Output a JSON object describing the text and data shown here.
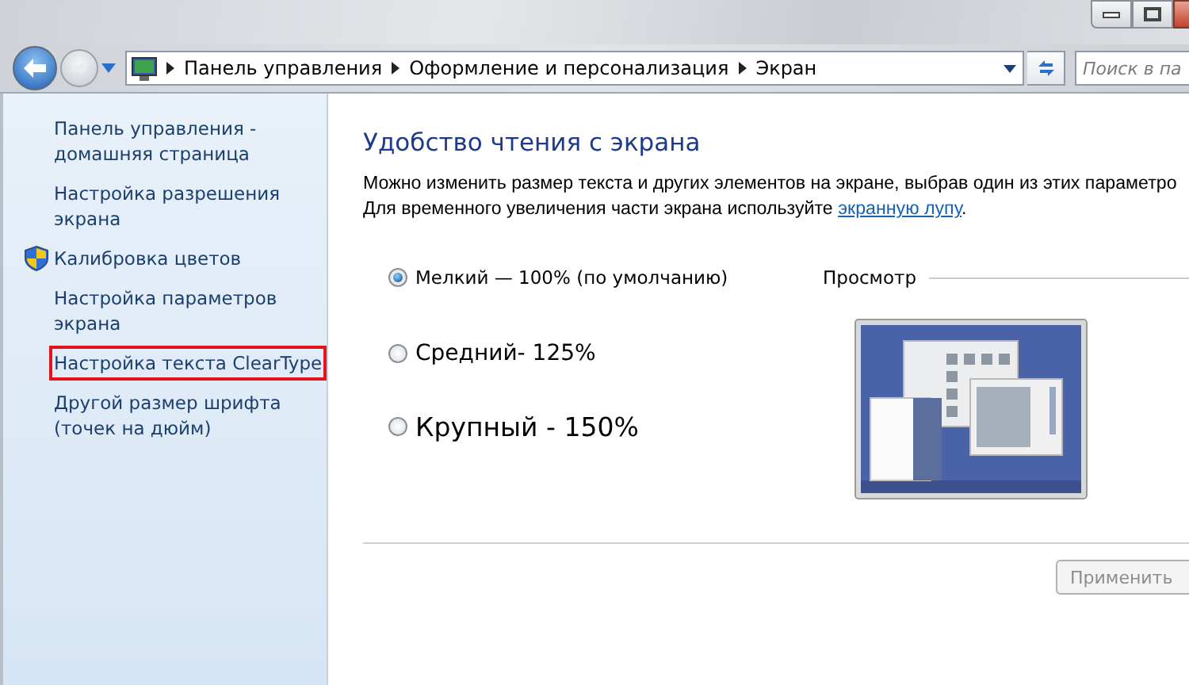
{
  "address_bar": {
    "breadcrumbs": [
      "Панель управления",
      "Оформление и персонализация",
      "Экран"
    ]
  },
  "search": {
    "placeholder": "Поиск в па"
  },
  "sidebar": {
    "items": [
      {
        "label": "Панель управления - домашняя страница",
        "shield": false,
        "highlighted": false
      },
      {
        "label": "Настройка разрешения экрана",
        "shield": false,
        "highlighted": false
      },
      {
        "label": "Калибровка цветов",
        "shield": true,
        "highlighted": false
      },
      {
        "label": "Настройка параметров экрана",
        "shield": false,
        "highlighted": false
      },
      {
        "label": "Настройка текста ClearType",
        "shield": false,
        "highlighted": true
      },
      {
        "label": "Другой размер шрифта (точек на дюйм)",
        "shield": false,
        "highlighted": false
      }
    ]
  },
  "content": {
    "heading": "Удобство чтения с экрана",
    "description": "Можно изменить размер текста и других элементов на экране, выбрав один из этих параметро",
    "hint": "Для временного увеличения части экрана используйте",
    "hint_link": "экранную лупу",
    "hint_end": ".",
    "preview_label": "Просмотр",
    "options": [
      {
        "label": "Мелкий — 100% (по умолчанию)",
        "kind": "small",
        "selected": true
      },
      {
        "label": "Средний- 125%",
        "kind": "medium",
        "selected": false
      },
      {
        "label": "Крупный - 150%",
        "kind": "large",
        "selected": false
      }
    ],
    "apply_button": {
      "label": "Применить",
      "disabled": true
    }
  }
}
